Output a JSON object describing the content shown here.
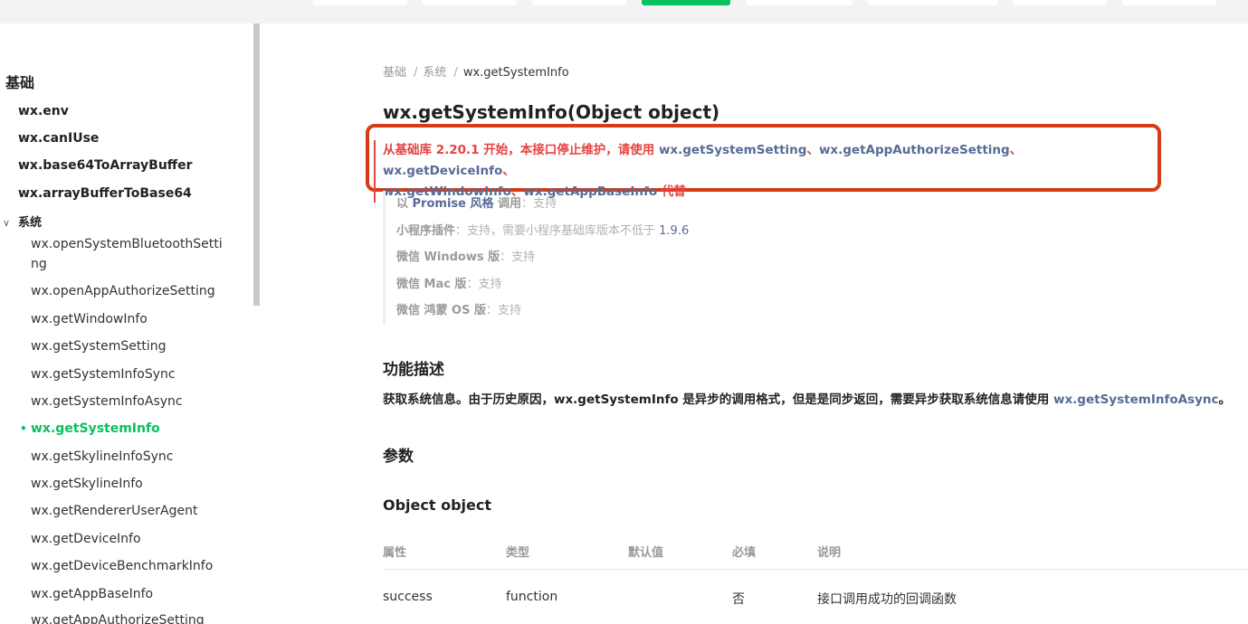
{
  "sidebar": {
    "section_title": "基础",
    "items": [
      "wx.env",
      "wx.canIUse",
      "wx.base64ToArrayBuffer",
      "wx.arrayBufferToBase64"
    ],
    "group": {
      "label": "系统",
      "chevron": "chevron-down-icon",
      "items": [
        "wx.openSystemBluetoothSetting",
        "wx.openAppAuthorizeSetting",
        "wx.getWindowInfo",
        "wx.getSystemSetting",
        "wx.getSystemInfoSync",
        "wx.getSystemInfoAsync",
        "wx.getSystemInfo",
        "wx.getSkylineInfoSync",
        "wx.getSkylineInfo",
        "wx.getRendererUserAgent",
        "wx.getDeviceInfo",
        "wx.getDeviceBenchmarkInfo",
        "wx.getAppBaseInfo",
        "wx.getAppAuthorizeSetting"
      ],
      "active": "wx.getSystemInfo"
    }
  },
  "breadcrumb": [
    "基础",
    "系统",
    "wx.getSystemInfo"
  ],
  "page_title": "wx.getSystemInfo(Object object)",
  "deprecation": {
    "prefix": "从基础库 2.20.1 开始，本接口停止维护，请使用 ",
    "links": [
      "wx.getSystemSetting",
      "wx.getAppAuthorizeSetting",
      "wx.getDeviceInfo",
      "wx.getWindowInfo",
      "wx.getAppBaseInfo"
    ],
    "separator": "、",
    "suffix": " 代替"
  },
  "support": {
    "promise": {
      "a": "以 ",
      "b": "Promise 风格",
      "c": " 调用",
      "d": "：支持"
    },
    "plugin": {
      "label": "小程序插件",
      "text": "：支持，需要小程序基础库版本不低于 ",
      "version": "1.9.6"
    },
    "windows": {
      "label": "微信 Windows 版",
      "text": "：支持"
    },
    "mac": {
      "label": "微信 Mac 版",
      "text": "：支持"
    },
    "harmony": {
      "label": "微信 鸿蒙 OS 版",
      "text": "：支持"
    }
  },
  "function_desc": {
    "heading": "功能描述",
    "text": "获取系统信息。由于历史原因，wx.getSystemInfo 是异步的调用格式，但是是同步返回，需要异步获取系统信息请使用 ",
    "link": "wx.getSystemInfoAsync",
    "end": "。"
  },
  "params": {
    "heading": "参数",
    "object_heading": "Object object",
    "columns": [
      "属性",
      "类型",
      "默认值",
      "必填",
      "说明"
    ],
    "rows": [
      [
        "success",
        "function",
        "",
        "否",
        "接口调用成功的回调函数"
      ]
    ]
  },
  "colors": {
    "accent": "#07c160",
    "link": "#576b95",
    "warning": "#e64340",
    "highlight_box": "#d73a16"
  }
}
